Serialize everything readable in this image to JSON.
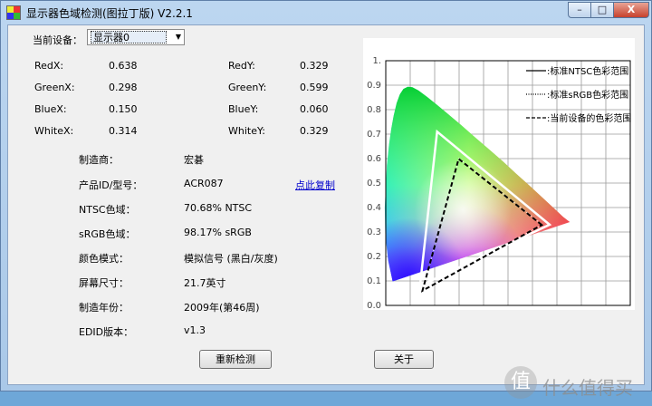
{
  "window": {
    "title": "显示器色域检测(图拉丁版) V2.2.1",
    "minimize_label": "–",
    "maximize_label": "□",
    "close_label": "X"
  },
  "device": {
    "label": "当前设备：",
    "selected": "显示器0"
  },
  "coords": {
    "red_x": {
      "label": "RedX:",
      "value": "0.638"
    },
    "red_y": {
      "label": "RedY:",
      "value": "0.329"
    },
    "green_x": {
      "label": "GreenX:",
      "value": "0.298"
    },
    "green_y": {
      "label": "GreenY:",
      "value": "0.599"
    },
    "blue_x": {
      "label": "BlueX:",
      "value": "0.150"
    },
    "blue_y": {
      "label": "BlueY:",
      "value": "0.060"
    },
    "white_x": {
      "label": "WhiteX:",
      "value": "0.314"
    },
    "white_y": {
      "label": "WhiteY:",
      "value": "0.329"
    }
  },
  "info": {
    "manufacturer": {
      "label": "制造商：",
      "value": "宏碁"
    },
    "product_id": {
      "label": "产品ID/型号：",
      "value": "ACR087"
    },
    "copy_link": "点此复制",
    "ntsc": {
      "label": "NTSC色域：",
      "value": "70.68% NTSC"
    },
    "srgb": {
      "label": "sRGB色域：",
      "value": "98.17% sRGB"
    },
    "color_mode": {
      "label": "颜色模式：",
      "value": "模拟信号 (黑白/灰度)"
    },
    "screen_size": {
      "label": "屏幕尺寸：",
      "value": "21.7英寸"
    },
    "year": {
      "label": "制造年份：",
      "value": "2009年(第46周)"
    },
    "edid": {
      "label": "EDID版本：",
      "value": "v1.3"
    }
  },
  "buttons": {
    "redetect": "重新检测",
    "about": "关于"
  },
  "chart_data": {
    "type": "scatter",
    "title": "",
    "xlabel": "",
    "ylabel": "",
    "xlim": [
      0,
      1.0
    ],
    "ylim": [
      0,
      1.0
    ],
    "x_ticks": [
      "0.0",
      "0.1",
      "0.2",
      "0.3",
      "0.4",
      "0.5",
      "0.6",
      "0.7",
      "0.8",
      "0.9",
      "1."
    ],
    "y_ticks": [
      "0.0",
      "0.1",
      "0.2",
      "0.3",
      "0.4",
      "0.5",
      "0.6",
      "0.7",
      "0.8",
      "0.9",
      "1."
    ],
    "grid": true,
    "legend": {
      "position": "top-right",
      "entries": [
        {
          "label": ":标准NTSC色彩范围",
          "style": "solid"
        },
        {
          "label": ":标准sRGB色彩范围",
          "style": "dotted"
        },
        {
          "label": ":当前设备的色彩范围",
          "style": "dashed"
        }
      ]
    },
    "series": [
      {
        "name": "标准NTSC色彩范围",
        "color": "#ffffff",
        "points": [
          [
            0.67,
            0.33
          ],
          [
            0.21,
            0.71
          ],
          [
            0.14,
            0.08
          ]
        ]
      },
      {
        "name": "标准sRGB色彩范围",
        "color": "#000000",
        "points": [
          [
            0.64,
            0.33
          ],
          [
            0.3,
            0.6
          ],
          [
            0.15,
            0.06
          ]
        ]
      },
      {
        "name": "当前设备的色彩范围",
        "color": "#000000",
        "points": [
          [
            0.638,
            0.329
          ],
          [
            0.298,
            0.599
          ],
          [
            0.15,
            0.06
          ]
        ]
      }
    ]
  },
  "watermark": {
    "icon": "值",
    "text": "什么值得买"
  }
}
